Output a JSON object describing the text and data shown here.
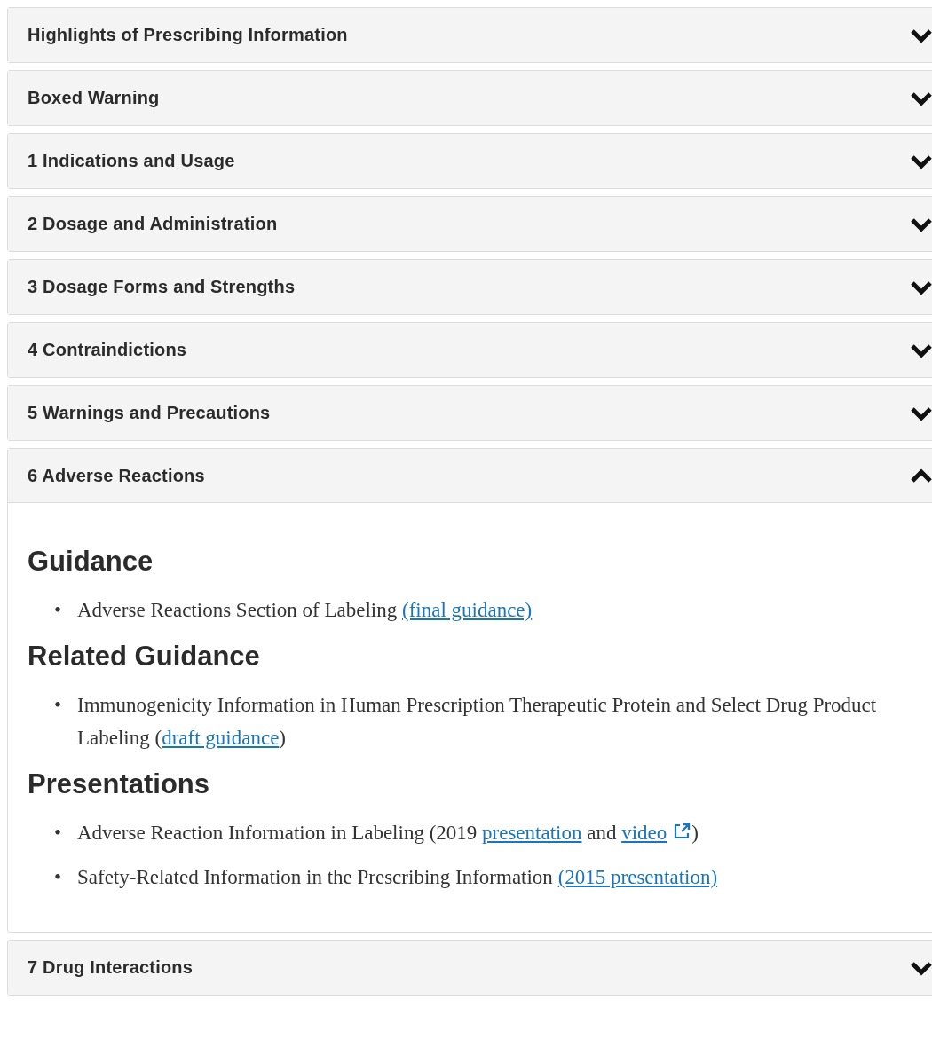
{
  "panels": [
    {
      "title": "Highlights of Prescribing Information",
      "expanded": false
    },
    {
      "title": "Boxed Warning",
      "expanded": false
    },
    {
      "title": "1 Indications and Usage",
      "expanded": false
    },
    {
      "title": "2 Dosage and Administration",
      "expanded": false
    },
    {
      "title": "3 Dosage Forms and Strengths",
      "expanded": false
    },
    {
      "title": "4 Contraindictions",
      "expanded": false
    },
    {
      "title": "5 Warnings and Precautions",
      "expanded": false
    },
    {
      "title": "6 Adverse Reactions",
      "expanded": true,
      "sections": [
        {
          "heading": "Guidance",
          "items": [
            {
              "bullet": "•",
              "parts": [
                {
                  "text": "Adverse Reactions Section of Labeling "
                },
                {
                  "link": "(final guidance)"
                }
              ]
            }
          ]
        },
        {
          "heading": "Related Guidance",
          "items": [
            {
              "bullet": "•",
              "parts": [
                {
                  "text": "Immunogenicity Information in Human Prescription Therapeutic Protein and Select Drug Product Labeling ("
                },
                {
                  "link": "draft guidance"
                },
                {
                  "text": ")"
                }
              ]
            }
          ]
        },
        {
          "heading": "Presentations",
          "items": [
            {
              "bullet": "•",
              "parts": [
                {
                  "text": "Adverse Reaction Information in Labeling (2019 "
                },
                {
                  "link": "presentation"
                },
                {
                  "text": " and "
                },
                {
                  "link": "video",
                  "external": true
                },
                {
                  "text": ")"
                }
              ]
            },
            {
              "bullet": "•",
              "parts": [
                {
                  "text": "Safety-Related Information in the Prescribing Information "
                },
                {
                  "link": "(2015 presentation)"
                }
              ]
            }
          ]
        }
      ]
    },
    {
      "title": "7 Drug Interactions",
      "expanded": false
    }
  ]
}
